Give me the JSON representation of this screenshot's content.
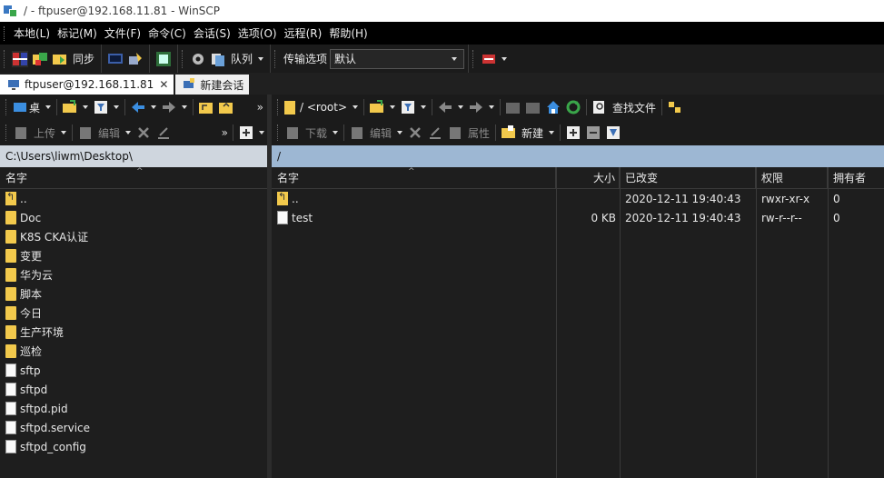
{
  "window": {
    "title": "/ - ftpuser@192.168.11.81 - WinSCP"
  },
  "menu": [
    "本地(L)",
    "标记(M)",
    "文件(F)",
    "命令(C)",
    "会话(S)",
    "选项(O)",
    "远程(R)",
    "帮助(H)"
  ],
  "toolbar": {
    "sync_label": "同步",
    "queue_label": "队列",
    "transfer_options_label": "传输选项",
    "transfer_options_value": "默认"
  },
  "tabs": {
    "session": "ftpuser@192.168.11.81",
    "close": "✕",
    "new_session": "新建会话"
  },
  "left": {
    "location": "桌",
    "upload_label": "上传",
    "edit_label": "编辑",
    "path": "C:\\Users\\liwm\\Desktop\\",
    "col_name": "名字",
    "files": [
      {
        "name": "..",
        "type": "parent"
      },
      {
        "name": "Doc",
        "type": "folder"
      },
      {
        "name": "K8S CKA认证",
        "type": "folder"
      },
      {
        "name": "变更",
        "type": "folder"
      },
      {
        "name": "华为云",
        "type": "folder"
      },
      {
        "name": "脚本",
        "type": "folder"
      },
      {
        "name": "今日",
        "type": "folder"
      },
      {
        "name": "生产环境",
        "type": "folder"
      },
      {
        "name": "巡检",
        "type": "folder"
      },
      {
        "name": "sftp",
        "type": "file"
      },
      {
        "name": "sftpd",
        "type": "file"
      },
      {
        "name": "sftpd.pid",
        "type": "file"
      },
      {
        "name": "sftpd.service",
        "type": "file"
      },
      {
        "name": "sftpd_config",
        "type": "file"
      }
    ]
  },
  "right": {
    "location": "/ <root>",
    "find_files_label": "查找文件",
    "download_label": "下载",
    "edit_label": "编辑",
    "properties_label": "属性",
    "new_label": "新建",
    "path": "/",
    "cols": {
      "name": "名字",
      "size": "大小",
      "modified": "已改变",
      "perms": "权限",
      "owner": "拥有者"
    },
    "files": [
      {
        "name": "..",
        "type": "parent",
        "size": "",
        "modified": "2020-12-11   19:40:43",
        "perms": "rwxr-xr-x",
        "owner": "0"
      },
      {
        "name": "test",
        "type": "file",
        "size": "0 KB",
        "modified": "2020-12-11   19:40:43",
        "perms": "rw-r--r--",
        "owner": "0"
      }
    ]
  },
  "more_glyph": "»",
  "colors": {
    "titlebar": "#ffffff",
    "menubar": "#000000",
    "left_path": "#cfd6de",
    "right_path": "#9db7d3",
    "folder": "#f2c94c"
  }
}
